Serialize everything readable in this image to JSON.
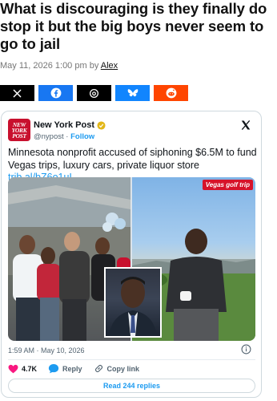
{
  "article": {
    "headline": "What is discouraging is they finally do stop it but the big boys never seem to go to jail",
    "date_prefix": "May 11, 2026 1:00 pm by",
    "author": "Alex"
  },
  "share_buttons": [
    {
      "name": "x",
      "icon": "x-logo-icon",
      "color": "#000000"
    },
    {
      "name": "facebook",
      "icon": "facebook-icon",
      "color": "#1877f2"
    },
    {
      "name": "threads",
      "icon": "threads-icon",
      "color": "#000000"
    },
    {
      "name": "bluesky",
      "icon": "bluesky-icon",
      "color": "#1185fe"
    },
    {
      "name": "reddit",
      "icon": "reddit-icon",
      "color": "#ff4500"
    }
  ],
  "tweet": {
    "account_name": "New York Post",
    "handle": "@nypost",
    "follow": "Follow",
    "avatar_line1": "NEW",
    "avatar_line2": "YORK",
    "avatar_line3": "POST",
    "text": "Minnesota nonprofit accused of siphoning $6.5M to fund Vegas trips, luxury cars, private liquor store",
    "link": "trib.al/bZ6o1uI",
    "image_badge": "Vegas golf trip",
    "timestamp": "1:59 AM · May 10, 2026",
    "likes": "4.7K",
    "reply_label": "Reply",
    "copy_link_label": "Copy link",
    "read_replies": "Read 244 replies"
  },
  "colors": {
    "link_blue": "#1d9bf0",
    "like_red": "#f91880",
    "badge_red": "#d6132a"
  }
}
